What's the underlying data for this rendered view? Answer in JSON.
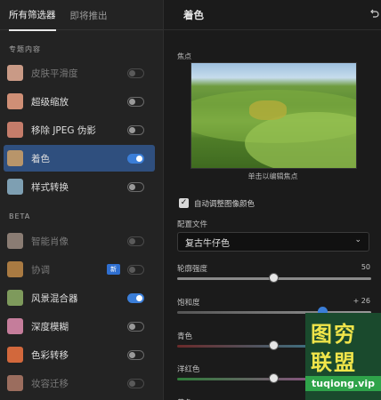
{
  "tabs": [
    {
      "label": "所有筛选器"
    },
    {
      "label": "即将推出"
    }
  ],
  "sections": {
    "featured": "专题内容",
    "beta": "BETA"
  },
  "featured_items": [
    {
      "label": "皮肤平滑度",
      "enabled": false,
      "disabled": true,
      "selected": false,
      "thumb": "#c99a86"
    },
    {
      "label": "超级缩放",
      "enabled": false,
      "disabled": false,
      "selected": false,
      "thumb": "#cf8f76"
    },
    {
      "label": "移除 JPEG 伪影",
      "enabled": false,
      "disabled": false,
      "selected": false,
      "thumb": "#c47c6a"
    },
    {
      "label": "着色",
      "enabled": true,
      "disabled": false,
      "selected": true,
      "thumb": "#b8956a"
    },
    {
      "label": "样式转换",
      "enabled": false,
      "disabled": false,
      "selected": false,
      "thumb": "#7e9fb2"
    }
  ],
  "beta_items": [
    {
      "label": "智能肖像",
      "enabled": false,
      "disabled": true,
      "badge": "",
      "thumb": "#8a7c73"
    },
    {
      "label": "协调",
      "enabled": false,
      "disabled": true,
      "badge": "新",
      "thumb": "#a97a42"
    },
    {
      "label": "风景混合器",
      "enabled": true,
      "disabled": false,
      "badge": "",
      "thumb": "#7e9a5c"
    },
    {
      "label": "深度模糊",
      "enabled": false,
      "disabled": false,
      "badge": "",
      "thumb": "#c57d9b"
    },
    {
      "label": "色彩转移",
      "enabled": false,
      "disabled": false,
      "badge": "",
      "thumb": "#d2683c"
    },
    {
      "label": "妆容迁移",
      "enabled": false,
      "disabled": true,
      "badge": "",
      "thumb": "#9b6d5e"
    }
  ],
  "panel": {
    "title": "着色",
    "reset_icon": "undo-icon",
    "focus_label": "焦点",
    "preview_caption": "单击以编辑焦点",
    "auto_adjust_label": "自动调整图像颜色",
    "auto_adjust_checked": true,
    "profile_label": "配置文件",
    "profile_value": "复古牛仔色"
  },
  "sliders": [
    {
      "label": "轮廓强度",
      "value_text": "50",
      "fraction": 0.5
    },
    {
      "label": "饱和度",
      "value_text": "+ 26",
      "fraction": 0.75
    },
    {
      "label": "青色",
      "value_text": "",
      "fraction": 0.5
    },
    {
      "label": "洋红色",
      "value_text": "",
      "fraction": 0.5
    },
    {
      "label": "黄色",
      "value_text": "",
      "fraction": 0.5
    }
  ],
  "watermark": {
    "line1": "图穷",
    "line2": "联盟",
    "url": "tuqiong.vip"
  },
  "colors": {
    "accent": "#3b7ed8",
    "selected_row": "#2f4f7e"
  }
}
